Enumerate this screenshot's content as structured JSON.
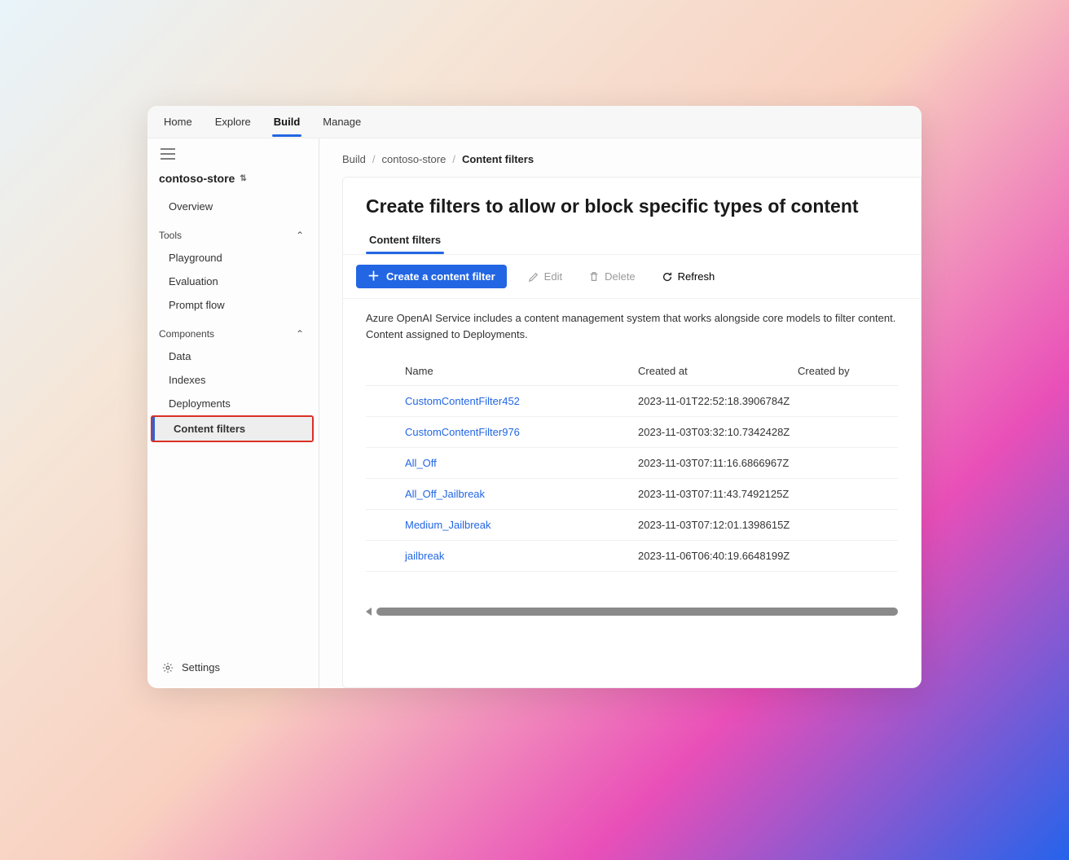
{
  "topnav": {
    "items": [
      "Home",
      "Explore",
      "Build",
      "Manage"
    ],
    "active": "Build"
  },
  "sidebar": {
    "store": "contoso-store",
    "overview": "Overview",
    "tools_header": "Tools",
    "tools": [
      "Playground",
      "Evaluation",
      "Prompt flow"
    ],
    "components_header": "Components",
    "components": [
      "Data",
      "Indexes",
      "Deployments",
      "Content filters"
    ],
    "selected": "Content filters",
    "settings": "Settings"
  },
  "breadcrumb": [
    "Build",
    "contoso-store",
    "Content filters"
  ],
  "panel": {
    "title": "Create filters to allow or block specific types of content",
    "tab": "Content filters",
    "create_btn": "Create a content filter",
    "edit_btn": "Edit",
    "delete_btn": "Delete",
    "refresh_btn": "Refresh",
    "description": "Azure OpenAI Service includes a content management system that works alongside core models to filter content. Content assigned to Deployments.",
    "columns": {
      "name": "Name",
      "created_at": "Created at",
      "created_by": "Created by"
    },
    "rows": [
      {
        "name": "CustomContentFilter452",
        "created_at": "2023-11-01T22:52:18.3906784Z"
      },
      {
        "name": "CustomContentFilter976",
        "created_at": "2023-11-03T03:32:10.7342428Z"
      },
      {
        "name": "All_Off",
        "created_at": "2023-11-03T07:11:16.6866967Z"
      },
      {
        "name": "All_Off_Jailbreak",
        "created_at": "2023-11-03T07:11:43.7492125Z"
      },
      {
        "name": "Medium_Jailbreak",
        "created_at": "2023-11-03T07:12:01.1398615Z"
      },
      {
        "name": "jailbreak",
        "created_at": "2023-11-06T06:40:19.6648199Z"
      }
    ]
  }
}
